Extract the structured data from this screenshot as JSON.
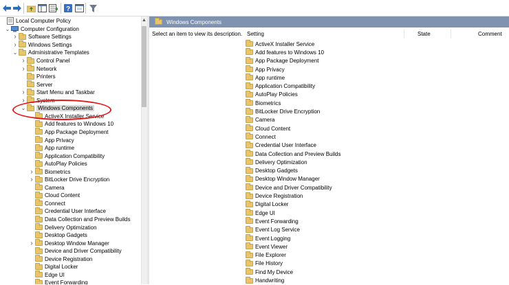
{
  "toolbar": {
    "icons": [
      "back-arrow-icon",
      "forward-arrow-icon",
      "up-folder-icon",
      "show-hide-tree-icon",
      "export-list-icon",
      "help-icon",
      "properties-icon",
      "filter-icon"
    ]
  },
  "tree": {
    "items": [
      {
        "label": "Local Computer Policy",
        "level": 0,
        "chevron": "",
        "icon": "policy-icon"
      },
      {
        "label": "Computer Configuration",
        "level": 1,
        "chevron": "⌄",
        "icon": "computer-icon"
      },
      {
        "label": "Software Settings",
        "level": 2,
        "chevron": ">",
        "icon": "folder-icon"
      },
      {
        "label": "Windows Settings",
        "level": 2,
        "chevron": ">",
        "icon": "folder-icon"
      },
      {
        "label": "Administrative Templates",
        "level": 2,
        "chevron": "⌄",
        "icon": "folder-icon"
      },
      {
        "label": "Control Panel",
        "level": 3,
        "chevron": ">",
        "icon": "folder-icon"
      },
      {
        "label": "Network",
        "level": 3,
        "chevron": ">",
        "icon": "folder-icon"
      },
      {
        "label": "Printers",
        "level": 3,
        "chevron": "",
        "icon": "folder-icon"
      },
      {
        "label": "Server",
        "level": 3,
        "chevron": "",
        "icon": "folder-icon"
      },
      {
        "label": "Start Menu and Taskbar",
        "level": 3,
        "chevron": ">",
        "icon": "folder-icon"
      },
      {
        "label": "System",
        "level": 3,
        "chevron": ">",
        "icon": "folder-icon"
      },
      {
        "label": "Windows Components",
        "level": 3,
        "chevron": "⌄",
        "icon": "folder-icon",
        "selected": true
      },
      {
        "label": "ActiveX Installer Service",
        "level": 4,
        "chevron": "",
        "icon": "folder-icon"
      },
      {
        "label": "Add features to Windows 10",
        "level": 4,
        "chevron": "",
        "icon": "folder-icon"
      },
      {
        "label": "App Package Deployment",
        "level": 4,
        "chevron": "",
        "icon": "folder-icon"
      },
      {
        "label": "App Privacy",
        "level": 4,
        "chevron": "",
        "icon": "folder-icon"
      },
      {
        "label": "App runtime",
        "level": 4,
        "chevron": "",
        "icon": "folder-icon"
      },
      {
        "label": "Application Compatibility",
        "level": 4,
        "chevron": "",
        "icon": "folder-icon"
      },
      {
        "label": "AutoPlay Policies",
        "level": 4,
        "chevron": "",
        "icon": "folder-icon"
      },
      {
        "label": "Biometrics",
        "level": 4,
        "chevron": ">",
        "icon": "folder-icon"
      },
      {
        "label": "BitLocker Drive Encryption",
        "level": 4,
        "chevron": ">",
        "icon": "folder-icon"
      },
      {
        "label": "Camera",
        "level": 4,
        "chevron": "",
        "icon": "folder-icon"
      },
      {
        "label": "Cloud Content",
        "level": 4,
        "chevron": "",
        "icon": "folder-icon"
      },
      {
        "label": "Connect",
        "level": 4,
        "chevron": "",
        "icon": "folder-icon"
      },
      {
        "label": "Credential User Interface",
        "level": 4,
        "chevron": "",
        "icon": "folder-icon"
      },
      {
        "label": "Data Collection and Preview Builds",
        "level": 4,
        "chevron": "",
        "icon": "folder-icon"
      },
      {
        "label": "Delivery Optimization",
        "level": 4,
        "chevron": "",
        "icon": "folder-icon"
      },
      {
        "label": "Desktop Gadgets",
        "level": 4,
        "chevron": "",
        "icon": "folder-icon"
      },
      {
        "label": "Desktop Window Manager",
        "level": 4,
        "chevron": ">",
        "icon": "folder-icon"
      },
      {
        "label": "Device and Driver Compatibility",
        "level": 4,
        "chevron": "",
        "icon": "folder-icon"
      },
      {
        "label": "Device Registration",
        "level": 4,
        "chevron": "",
        "icon": "folder-icon"
      },
      {
        "label": "Digital Locker",
        "level": 4,
        "chevron": "",
        "icon": "folder-icon"
      },
      {
        "label": "Edge UI",
        "level": 4,
        "chevron": "",
        "icon": "folder-icon"
      },
      {
        "label": "Event Forwarding",
        "level": 4,
        "chevron": "",
        "icon": "folder-icon"
      }
    ]
  },
  "details": {
    "header_title": "Windows Components",
    "description": "Select an item to view its description.",
    "columns": [
      "Setting",
      "State",
      "Comment"
    ],
    "items": [
      "ActiveX Installer Service",
      "Add features to Windows 10",
      "App Package Deployment",
      "App Privacy",
      "App runtime",
      "Application Compatibility",
      "AutoPlay Policies",
      "Biometrics",
      "BitLocker Drive Encryption",
      "Camera",
      "Cloud Content",
      "Connect",
      "Credential User Interface",
      "Data Collection and Preview Builds",
      "Delivery Optimization",
      "Desktop Gadgets",
      "Desktop Window Manager",
      "Device and Driver Compatibility",
      "Device Registration",
      "Digital Locker",
      "Edge UI",
      "Event Forwarding",
      "Event Log Service",
      "Event Logging",
      "Event Viewer",
      "File Explorer",
      "File History",
      "Find My Device",
      "Handwriting"
    ]
  },
  "colors": {
    "header_band": "#7f93b0",
    "annotation": "#e4181c",
    "folder": "#e9c56a"
  }
}
